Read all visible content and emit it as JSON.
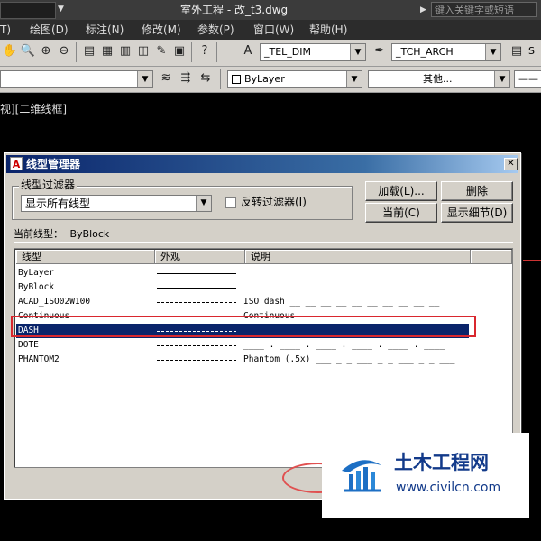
{
  "titlebar": {
    "title": "室外工程 - 改_t3.dwg",
    "search_placeholder": "键入关键字或短语"
  },
  "menubar": {
    "items": [
      "T)",
      "绘图(D)",
      "标注(N)",
      "修改(M)",
      "参数(P)",
      "窗口(W)",
      "帮助(H)"
    ]
  },
  "toolbar1": {
    "dim_style": "_TEL_DIM",
    "text_style": "_TCH_ARCH",
    "trailing": "S"
  },
  "toolbar2": {
    "color_combo": "ByLayer",
    "linetype_combo": "其他...",
    "lineweight_combo": "——"
  },
  "viewport": {
    "label": "视][二维线框]"
  },
  "colors": {
    "selection": "#0a246a",
    "highlight_outline": "#d9272e",
    "dialog_bg": "#d4d0c8"
  },
  "dialog": {
    "title": "线型管理器",
    "close_icon": "close-icon",
    "filter_group_label": "线型过滤器",
    "filter_value": "显示所有线型",
    "invert_filter_label": "反转过滤器(I)",
    "invert_filter_checked": false,
    "buttons": {
      "load": "加载(L)...",
      "delete": "删除",
      "current": "当前(C)",
      "show_details": "显示细节(D)"
    },
    "current_linetype_label": "当前线型：",
    "current_linetype_value": "ByBlock",
    "columns": [
      "线型",
      "外观",
      "说明"
    ],
    "rows": [
      {
        "name": "ByLayer",
        "look": "solid",
        "desc": ""
      },
      {
        "name": "ByBlock",
        "look": "solid",
        "desc": ""
      },
      {
        "name": "ACAD_ISO02W100",
        "look": "dash",
        "desc": "ISO dash __ __ __ __ __ __ __ __ __ __"
      },
      {
        "name": "Continuous",
        "look": "solid",
        "desc": "Continuous"
      },
      {
        "name": "DASH",
        "look": "dash",
        "desc": "__ __ __ __ __ __ __ __ __ __ __ __ __ __",
        "selected": true
      },
      {
        "name": "DOTE",
        "look": "dashdot",
        "desc": "____ . ____ . ____ . ____ . ____ . ____"
      },
      {
        "name": "PHANTOM2",
        "look": "phantom",
        "desc": "Phantom (.5x) ___ _ _ ___ _ _ ___ _ _ ___"
      }
    ]
  },
  "watermark": {
    "title": "土木工程网",
    "url": "www.civilcn.com"
  }
}
